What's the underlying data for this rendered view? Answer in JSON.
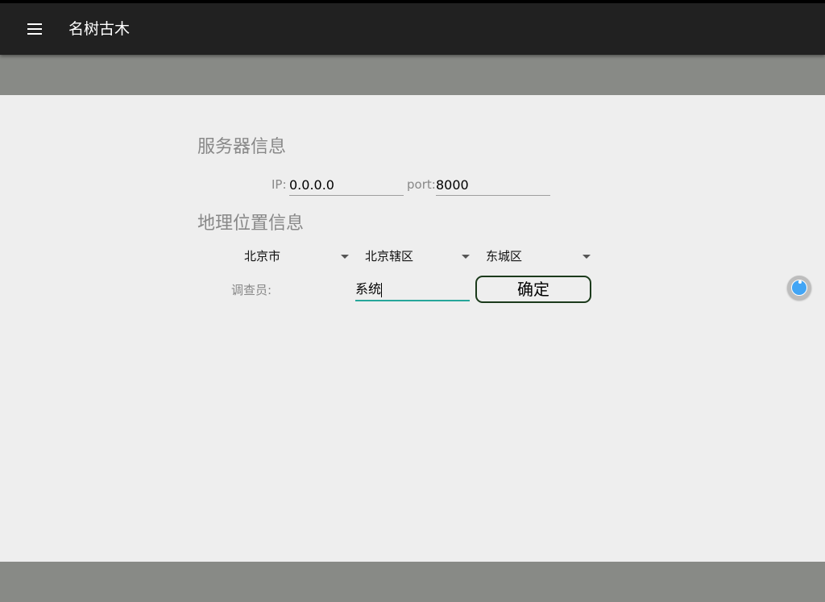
{
  "app": {
    "title": "名树古木"
  },
  "server": {
    "section_title": "服务器信息",
    "ip_label": "IP:",
    "ip_value": "0.0.0.0",
    "port_label": "port:",
    "port_value": "8000"
  },
  "location": {
    "section_title": "地理位置信息",
    "province": "北京市",
    "city": "北京辖区",
    "district": "东城区"
  },
  "surveyor": {
    "label": "调查员:",
    "value": "系统"
  },
  "actions": {
    "confirm_label": "确定"
  },
  "colors": {
    "appbar": "#212121",
    "band": "#888a86",
    "background": "#eeeeee",
    "accent": "#26a69a",
    "float_button": "#42a5f5"
  }
}
